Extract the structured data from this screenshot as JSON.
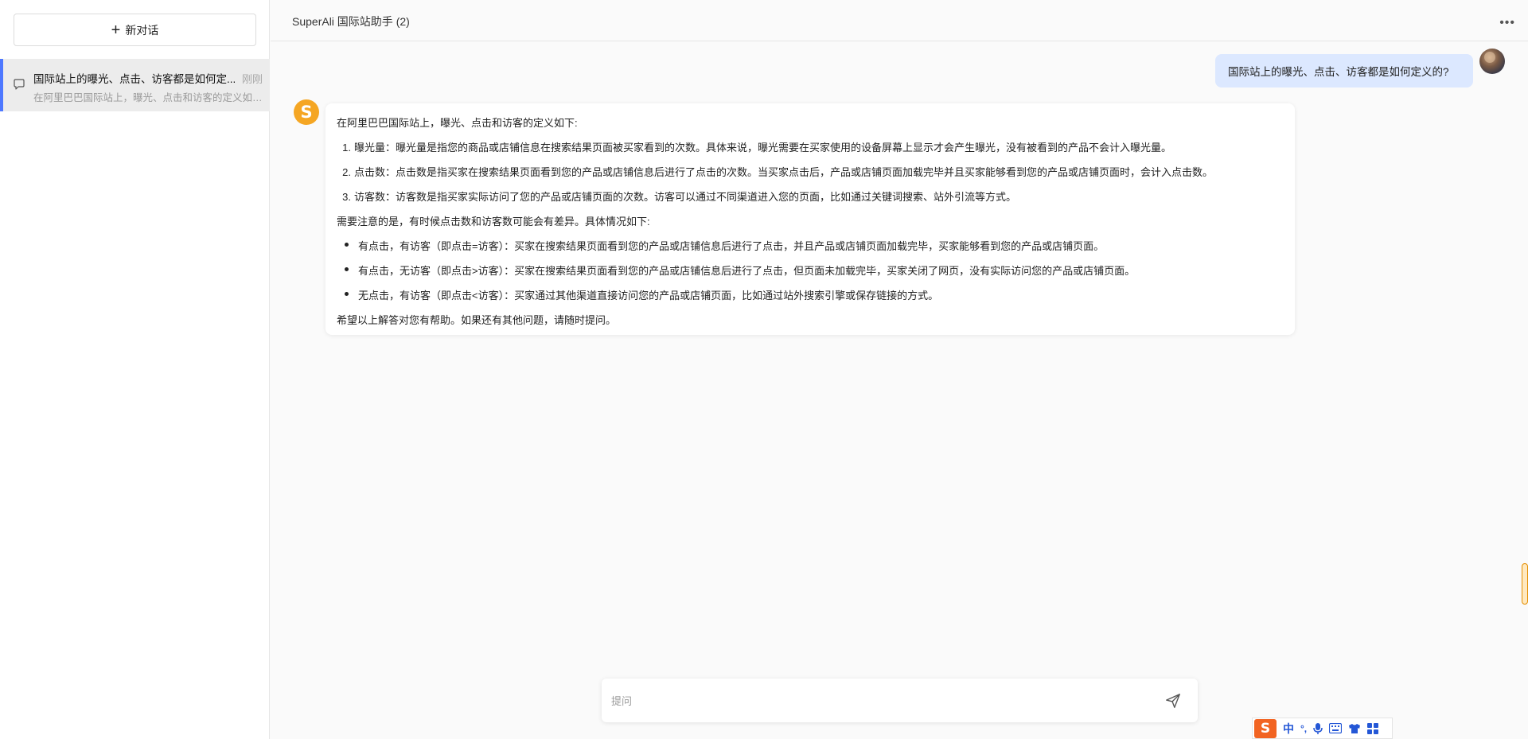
{
  "sidebar": {
    "new_chat_label": "新对话",
    "conversations": [
      {
        "title": "国际站上的曝光、点击、访客都是如何定...",
        "time": "刚刚",
        "preview": "在阿里巴巴国际站上，曝光、点击和访客的定义如下..."
      }
    ]
  },
  "header": {
    "title": "SuperAli 国际站助手 (2)",
    "more_icon": "more-icon"
  },
  "messages": {
    "user": "国际站上的曝光、点击、访客都是如何定义的?",
    "bot": {
      "intro": "在阿里巴巴国际站上，曝光、点击和访客的定义如下:",
      "numbered": [
        {
          "num": "1.",
          "text": "曝光量：曝光量是指您的商品或店铺信息在搜索结果页面被买家看到的次数。具体来说，曝光需要在买家使用的设备屏幕上显示才会产生曝光，没有被看到的产品不会计入曝光量。"
        },
        {
          "num": "2.",
          "text": "点击数：点击数是指买家在搜索结果页面看到您的产品或店铺信息后进行了点击的次数。当买家点击后，产品或店铺页面加载完毕并且买家能够看到您的产品或店铺页面时，会计入点击数。"
        },
        {
          "num": "3.",
          "text": "访客数：访客数是指买家实际访问了您的产品或店铺页面的次数。访客可以通过不同渠道进入您的页面，比如通过关键词搜索、站外引流等方式。"
        }
      ],
      "note": "需要注意的是，有时候点击数和访客数可能会有差异。具体情况如下:",
      "bullets": [
        "有点击，有访客（即点击=访客）：买家在搜索结果页面看到您的产品或店铺信息后进行了点击，并且产品或店铺页面加载完毕，买家能够看到您的产品或店铺页面。",
        "有点击，无访客（即点击>访客）：买家在搜索结果页面看到您的产品或店铺信息后进行了点击，但页面未加载完毕，买家关闭了网页，没有实际访问您的产品或店铺页面。",
        "无点击，有访客（即点击<访客）：买家通过其他渠道直接访问您的产品或店铺页面，比如通过站外搜索引擎或保存链接的方式。"
      ],
      "closing": "希望以上解答对您有帮助。如果还有其他问题，请随时提问。"
    }
  },
  "input": {
    "placeholder": "提问",
    "value": ""
  },
  "ime": {
    "logo": "S",
    "mode": "中",
    "punct": "°,",
    "icons": [
      "microphone-icon",
      "keyboard-icon",
      "shirt-icon",
      "grid-icon"
    ]
  },
  "colors": {
    "accent": "#4e78ff",
    "user_bubble": "#dce8ff",
    "bot_avatar": "#f5a623",
    "ime_logo": "#f26422"
  }
}
